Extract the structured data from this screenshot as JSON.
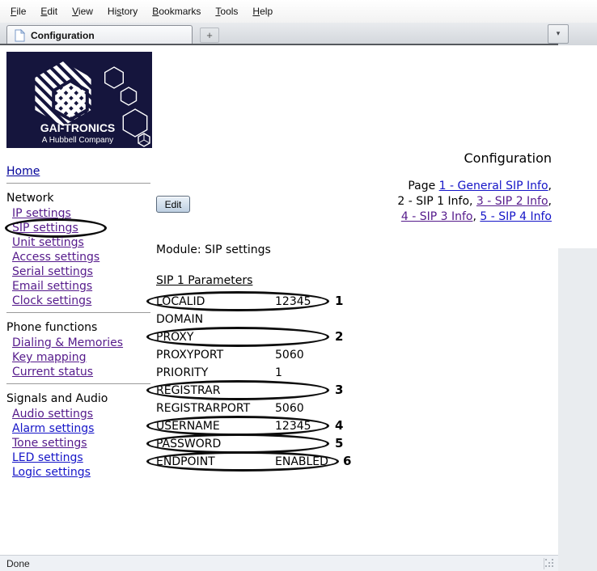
{
  "menu_bar": {
    "items": [
      {
        "label": "File",
        "u": 0
      },
      {
        "label": "Edit",
        "u": 0
      },
      {
        "label": "View",
        "u": 0
      },
      {
        "label": "History",
        "u": 2
      },
      {
        "label": "Bookmarks",
        "u": 0
      },
      {
        "label": "Tools",
        "u": 0
      },
      {
        "label": "Help",
        "u": 0
      }
    ]
  },
  "tab_bar": {
    "active_tab_title": "Configuration",
    "new_tab_label": "+",
    "tab_list_arrow": "▾"
  },
  "logo": {
    "brand": "GAI-TRONICS",
    "tagline": "A Hubbell Company",
    "background_color": "#15153d"
  },
  "sidebar": {
    "home": {
      "label": "Home"
    },
    "sections": [
      {
        "heading": "Network",
        "links": [
          {
            "label": "IP settings",
            "visited": true,
            "circled": false
          },
          {
            "label": "SIP settings",
            "visited": true,
            "circled": true
          },
          {
            "label": "Unit settings",
            "visited": true,
            "circled": false
          },
          {
            "label": "Access settings",
            "visited": true,
            "circled": false
          },
          {
            "label": "Serial settings",
            "visited": true,
            "circled": false
          },
          {
            "label": "Email settings",
            "visited": true,
            "circled": false
          },
          {
            "label": "Clock settings",
            "visited": true,
            "circled": false
          }
        ]
      },
      {
        "heading": "Phone functions",
        "links": [
          {
            "label": "Dialing & Memories",
            "visited": true,
            "circled": false
          },
          {
            "label": "Key mapping",
            "visited": true,
            "circled": false
          },
          {
            "label": "Current status",
            "visited": true,
            "circled": false
          }
        ]
      },
      {
        "heading": "Signals and Audio",
        "links": [
          {
            "label": "Audio settings",
            "visited": true,
            "circled": false
          },
          {
            "label": "Alarm settings",
            "visited": false,
            "circled": false
          },
          {
            "label": "Tone settings",
            "visited": true,
            "circled": false
          },
          {
            "label": "LED settings",
            "visited": false,
            "circled": false
          },
          {
            "label": "Logic settings",
            "visited": false,
            "circled": false
          }
        ]
      }
    ]
  },
  "main": {
    "title": "Configuration",
    "page_nav_lines": [
      [
        {
          "text": "Page ",
          "link": false
        },
        {
          "text": "1 - General SIP Info",
          "link": true,
          "visited": false
        },
        {
          "text": ",",
          "link": false
        }
      ],
      [
        {
          "text": "2 - SIP 1 Info, ",
          "link": false
        },
        {
          "text": "3 - SIP 2 Info",
          "link": true,
          "visited": true
        },
        {
          "text": ",",
          "link": false
        }
      ],
      [
        {
          "text": "4 - SIP 3 Info",
          "link": true,
          "visited": true
        },
        {
          "text": ", ",
          "link": false
        },
        {
          "text": "5 - SIP 4 Info",
          "link": true,
          "visited": false
        }
      ]
    ],
    "edit_button_label": "Edit",
    "module_line": "Module: SIP settings",
    "params_heading": "SIP 1 Parameters",
    "params": [
      {
        "name": "LOCALID",
        "value": "12345",
        "annotation": "1",
        "wide_circle": false
      },
      {
        "name": "DOMAIN",
        "value": "",
        "annotation": null,
        "wide_circle": false
      },
      {
        "name": "PROXY",
        "value": "",
        "annotation": "2",
        "wide_circle": false
      },
      {
        "name": "PROXYPORT",
        "value": "5060",
        "annotation": null,
        "wide_circle": false
      },
      {
        "name": "PRIORITY",
        "value": "1",
        "annotation": null,
        "wide_circle": false
      },
      {
        "name": "REGISTRAR",
        "value": "",
        "annotation": "3",
        "wide_circle": false
      },
      {
        "name": "REGISTRARPORT",
        "value": "5060",
        "annotation": null,
        "wide_circle": false
      },
      {
        "name": "USERNAME",
        "value": "12345",
        "annotation": "4",
        "wide_circle": false
      },
      {
        "name": "PASSWORD",
        "value": "",
        "annotation": "5",
        "wide_circle": false
      },
      {
        "name": "ENDPOINT",
        "value": "ENABLED",
        "annotation": "6",
        "wide_circle": true
      }
    ]
  },
  "status_bar": {
    "text": "Done"
  },
  "colors": {
    "link_blue": "#1515c8",
    "link_visited": "#551a8b",
    "home_link": "#000099",
    "annotation_ink": "#0c0c0c",
    "logo_navy": "#15153d"
  }
}
